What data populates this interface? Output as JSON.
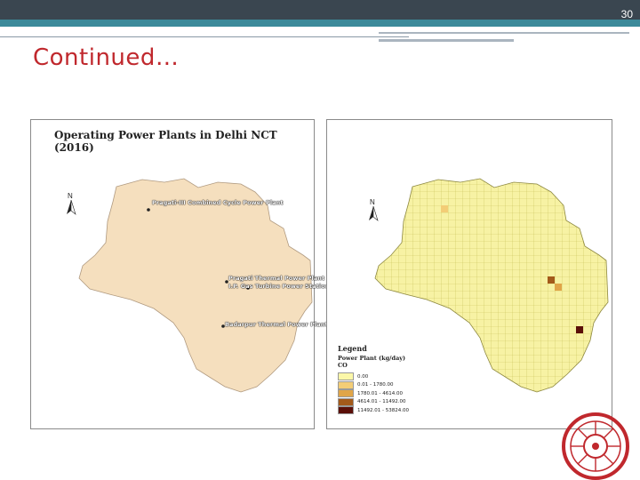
{
  "slide": {
    "number": "30",
    "title": "Continued…"
  },
  "left_map": {
    "title": "Operating Power Plants in Delhi NCT (2016)",
    "north_label": "N",
    "fill_color": "#f5dfbe",
    "plants": [
      "Pragati-III Combined Cycle Power Plant",
      "Pragati Thermal Power Plant",
      "I.P. Gas Turbine Power Station",
      "Badarpur Thermal Power Plant"
    ]
  },
  "right_map": {
    "north_label": "N",
    "fill_color": "#f7f2a4",
    "grid_color": "#c9c35a",
    "legend": {
      "title": "Legend",
      "subtitle": "Power Plant (kg/day)",
      "pollutant": "CO",
      "classes": [
        {
          "label": "0.00",
          "color": "#fbf7a8"
        },
        {
          "label": "0.01 - 1780.00",
          "color": "#f3cd76"
        },
        {
          "label": "1780.01 - 4614.00",
          "color": "#e0a548"
        },
        {
          "label": "4614.01 - 11492.00",
          "color": "#a35a1a"
        },
        {
          "label": "11492.01 - 53824.00",
          "color": "#5a0f08"
        }
      ]
    }
  },
  "logo": {
    "name": "institute-emblem",
    "color": "#c0282d"
  }
}
